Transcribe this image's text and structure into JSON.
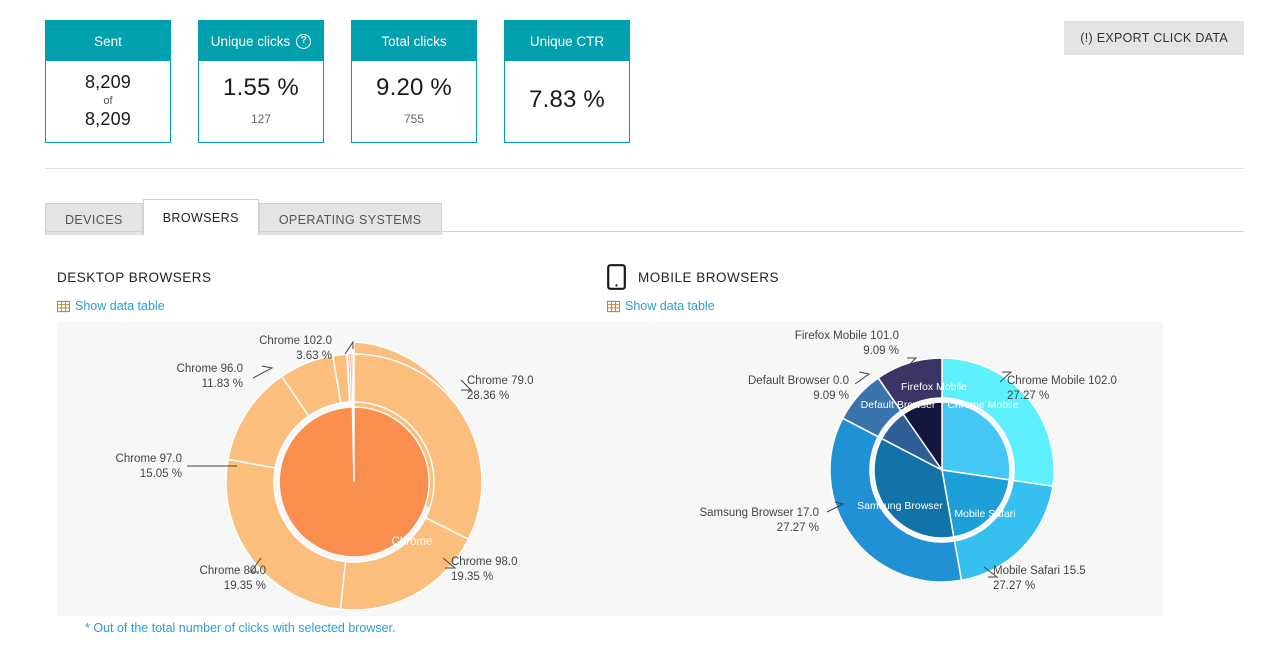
{
  "kpis": [
    {
      "label": "Sent",
      "help": false,
      "value": "8,209",
      "of_text": "of",
      "value2": "8,209",
      "sub": ""
    },
    {
      "label": "Unique clicks",
      "help": true,
      "help_glyph": "?",
      "value": "1.55 %",
      "sub": "127"
    },
    {
      "label": "Total clicks",
      "help": false,
      "value": "9.20 %",
      "sub": "755"
    },
    {
      "label": "Unique CTR",
      "help": false,
      "value": "7.83 %",
      "sub": ""
    }
  ],
  "toolbar": {
    "export_label": "(!) EXPORT CLICK DATA"
  },
  "tabs": [
    {
      "label": "DEVICES",
      "active": false
    },
    {
      "label": "BROWSERS",
      "active": true
    },
    {
      "label": "OPERATING SYSTEMS",
      "active": false
    }
  ],
  "sections": {
    "desktop": {
      "title": "DESKTOP BROWSERS",
      "data_table_link": "Show data table"
    },
    "mobile": {
      "title": "MOBILE BROWSERS",
      "data_table_link": "Show data table"
    }
  },
  "footnote": "* Out of the total number of clicks with selected browser.",
  "colors": {
    "teal": "#00a0ae",
    "link": "#2a9fd6",
    "panel_bg": "#f7f7f7",
    "tab_inactive": "#e4e4e4",
    "export_bg": "#e4e4e4",
    "desktop_inner": "#f98e4f",
    "desktop_outer": "#fbbe7d",
    "mobile_inner_chrome": "#45c6f5",
    "mobile_outer_chrome": "#5ef0fd"
  },
  "chart_data": [
    {
      "type": "pie",
      "title": "DESKTOP BROWSERS",
      "variant": "nested-donut",
      "inner_ring": {
        "labels": [
          "Chrome"
        ],
        "values": [
          100.0
        ],
        "colors": [
          "#f98e4f"
        ],
        "label_color": "#ffffff"
      },
      "outer_ring": {
        "labels": [
          "Chrome 79.0",
          "Chrome 98.0",
          "Chrome 80.0",
          "Chrome 97.0",
          "Chrome 96.0",
          "Chrome 102.0"
        ],
        "values": [
          28.36,
          19.35,
          19.35,
          15.05,
          11.83,
          3.63
        ],
        "value_suffix": " %",
        "colors": [
          "#fbbe7d",
          "#fbbe7d",
          "#fbbe7d",
          "#fbbe7d",
          "#fbbe7d",
          "#fbbe7d"
        ]
      },
      "annotations": [
        {
          "label": "Chrome 102.0",
          "value": "3.63 %"
        },
        {
          "label": "Chrome 96.0",
          "value": "11.83 %"
        },
        {
          "label": "Chrome 97.0",
          "value": "15.05 %"
        },
        {
          "label": "Chrome 79.0",
          "value": "28.36 %"
        },
        {
          "label": "Chrome 98.0",
          "value": "19.35 %"
        },
        {
          "label": "Chrome 80.0",
          "value": "19.35 %"
        }
      ]
    },
    {
      "type": "pie",
      "title": "MOBILE BROWSERS",
      "variant": "nested-donut",
      "inner_ring": {
        "labels": [
          "Chrome Mobile",
          "Mobile Safari",
          "Samsung Browser",
          "Default Browser",
          "Firefox Mobile"
        ],
        "values": [
          27.27,
          27.27,
          27.27,
          9.09,
          9.09
        ],
        "colors": [
          "#45c6f5",
          "#1e9fd8",
          "#1273a8",
          "#2d5f96",
          "#14143c"
        ],
        "label_color": "#ffffff"
      },
      "outer_ring": {
        "labels": [
          "Chrome Mobile 102.0",
          "Mobile Safari 15.5",
          "Samsung Browser 17.0",
          "Default Browser 0.0",
          "Firefox Mobile 101.0"
        ],
        "values": [
          27.27,
          27.27,
          27.27,
          9.09,
          9.09
        ],
        "value_suffix": " %",
        "colors": [
          "#5ef0fd",
          "#35c0f0",
          "#2091d4",
          "#3a74ad",
          "#3a3566"
        ]
      },
      "annotations": [
        {
          "label": "Firefox Mobile 101.0",
          "value": "9.09 %"
        },
        {
          "label": "Default Browser 0.0",
          "value": "9.09 %"
        },
        {
          "label": "Chrome Mobile 102.0",
          "value": "27.27 %"
        },
        {
          "label": "Samsung Browser 17.0",
          "value": "27.27 %"
        },
        {
          "label": "Mobile Safari 15.5",
          "value": "27.27 %"
        }
      ]
    }
  ]
}
